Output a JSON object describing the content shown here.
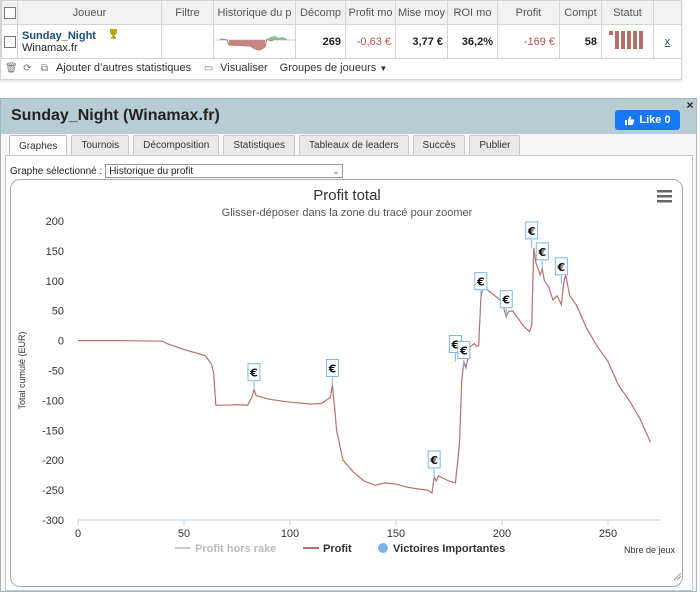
{
  "table": {
    "headers": [
      "",
      "Joueur",
      "Filtre",
      "Historique du p",
      "Décomp",
      "Profit mo",
      "Mise moy",
      "ROI mo",
      "Profit",
      "Compt",
      "Statut",
      ""
    ],
    "row": {
      "player_name": "Sunday_Night",
      "player_site": "Winamax.fr",
      "decomp": "269",
      "profit_moy": "-0,63 €",
      "mise_moy": "3,77 €",
      "roi_moy": "36,2%",
      "profit": "-169 €",
      "compt": "58",
      "remove_link": "x"
    }
  },
  "toolbar": {
    "add_stats": "Ajouter d’autres statistiques",
    "visualize": "Visualiser",
    "groups": "Groupes de joueurs"
  },
  "panel": {
    "title": "Sunday_Night (Winamax.fr)",
    "like_label": "Like 0",
    "close_symbol": "×"
  },
  "tabs": [
    {
      "label": "Graphes",
      "active": true
    },
    {
      "label": "Tournois",
      "active": false
    },
    {
      "label": "Décomposition",
      "active": false
    },
    {
      "label": "Statistiques",
      "active": false
    },
    {
      "label": "Tableaux de leaders",
      "active": false
    },
    {
      "label": "Succès",
      "active": false
    },
    {
      "label": "Publier",
      "active": false
    }
  ],
  "graph_select": {
    "label": "Graphe sélectionné :",
    "value": "Historique du profit"
  },
  "colors": {
    "profit": "#b5706c",
    "hors_rake": "#cccccc",
    "victoires": "#7cb5ec",
    "axis": "#c0d0e0"
  },
  "chart_data": {
    "type": "line",
    "title": "Profit total",
    "subtitle": "Glisser-déposer dans la zone du tracé pour zoomer",
    "ylabel": "Total cumulé (EUR)",
    "xlabel": "Nbre de jeux",
    "xlim": [
      0,
      275
    ],
    "ylim": [
      -300,
      200
    ],
    "xticks": [
      0,
      50,
      100,
      150,
      200,
      250
    ],
    "yticks": [
      -300,
      -250,
      -200,
      -150,
      -100,
      -50,
      0,
      50,
      100,
      150,
      200
    ],
    "legend": [
      "Profit hors rake",
      "Profit",
      "Victoires Importantes"
    ],
    "series": [
      {
        "name": "Profit",
        "x": [
          0,
          20,
          40,
          42,
          50,
          55,
          60,
          63,
          64,
          65,
          70,
          75,
          80,
          82,
          83,
          84,
          90,
          100,
          110,
          115,
          119,
          120,
          121,
          122,
          125,
          130,
          135,
          140,
          145,
          150,
          155,
          160,
          165,
          167,
          168,
          169,
          170,
          175,
          178,
          179,
          180,
          181,
          182,
          183,
          185,
          187,
          188,
          189,
          190,
          191,
          195,
          200,
          202,
          203,
          205,
          210,
          213,
          214,
          215,
          216,
          218,
          219,
          220,
          222,
          224,
          226,
          228,
          229,
          230,
          232,
          235,
          240,
          245,
          250,
          255,
          260,
          265,
          270
        ],
        "y": [
          0,
          0,
          -1,
          -5,
          -15,
          -20,
          -25,
          -40,
          -55,
          -108,
          -108,
          -107,
          -108,
          -95,
          -82,
          -92,
          -98,
          -103,
          -106,
          -105,
          -95,
          -75,
          -110,
          -150,
          -200,
          -220,
          -235,
          -242,
          -238,
          -240,
          -245,
          -248,
          -250,
          -255,
          -228,
          -235,
          -226,
          -235,
          -238,
          -205,
          -168,
          -68,
          -35,
          -45,
          -10,
          -5,
          -10,
          -8,
          70,
          90,
          80,
          65,
          40,
          48,
          50,
          25,
          15,
          25,
          155,
          130,
          110,
          120,
          100,
          90,
          68,
          75,
          60,
          95,
          110,
          75,
          60,
          20,
          -10,
          -35,
          -75,
          -100,
          -130,
          -170
        ]
      }
    ],
    "victoires_importantes": [
      {
        "x": 83,
        "y": -82,
        "label": "€"
      },
      {
        "x": 120,
        "y": -75,
        "label": "€"
      },
      {
        "x": 168,
        "y": -228,
        "label": "€"
      },
      {
        "x": 178,
        "y": -35,
        "label": "€"
      },
      {
        "x": 182,
        "y": -45,
        "label": "€"
      },
      {
        "x": 190,
        "y": 70,
        "label": "€"
      },
      {
        "x": 202,
        "y": 40,
        "label": "€"
      },
      {
        "x": 214,
        "y": 155,
        "label": "€"
      },
      {
        "x": 219,
        "y": 120,
        "label": "€"
      },
      {
        "x": 228,
        "y": 95,
        "label": "€"
      }
    ]
  }
}
